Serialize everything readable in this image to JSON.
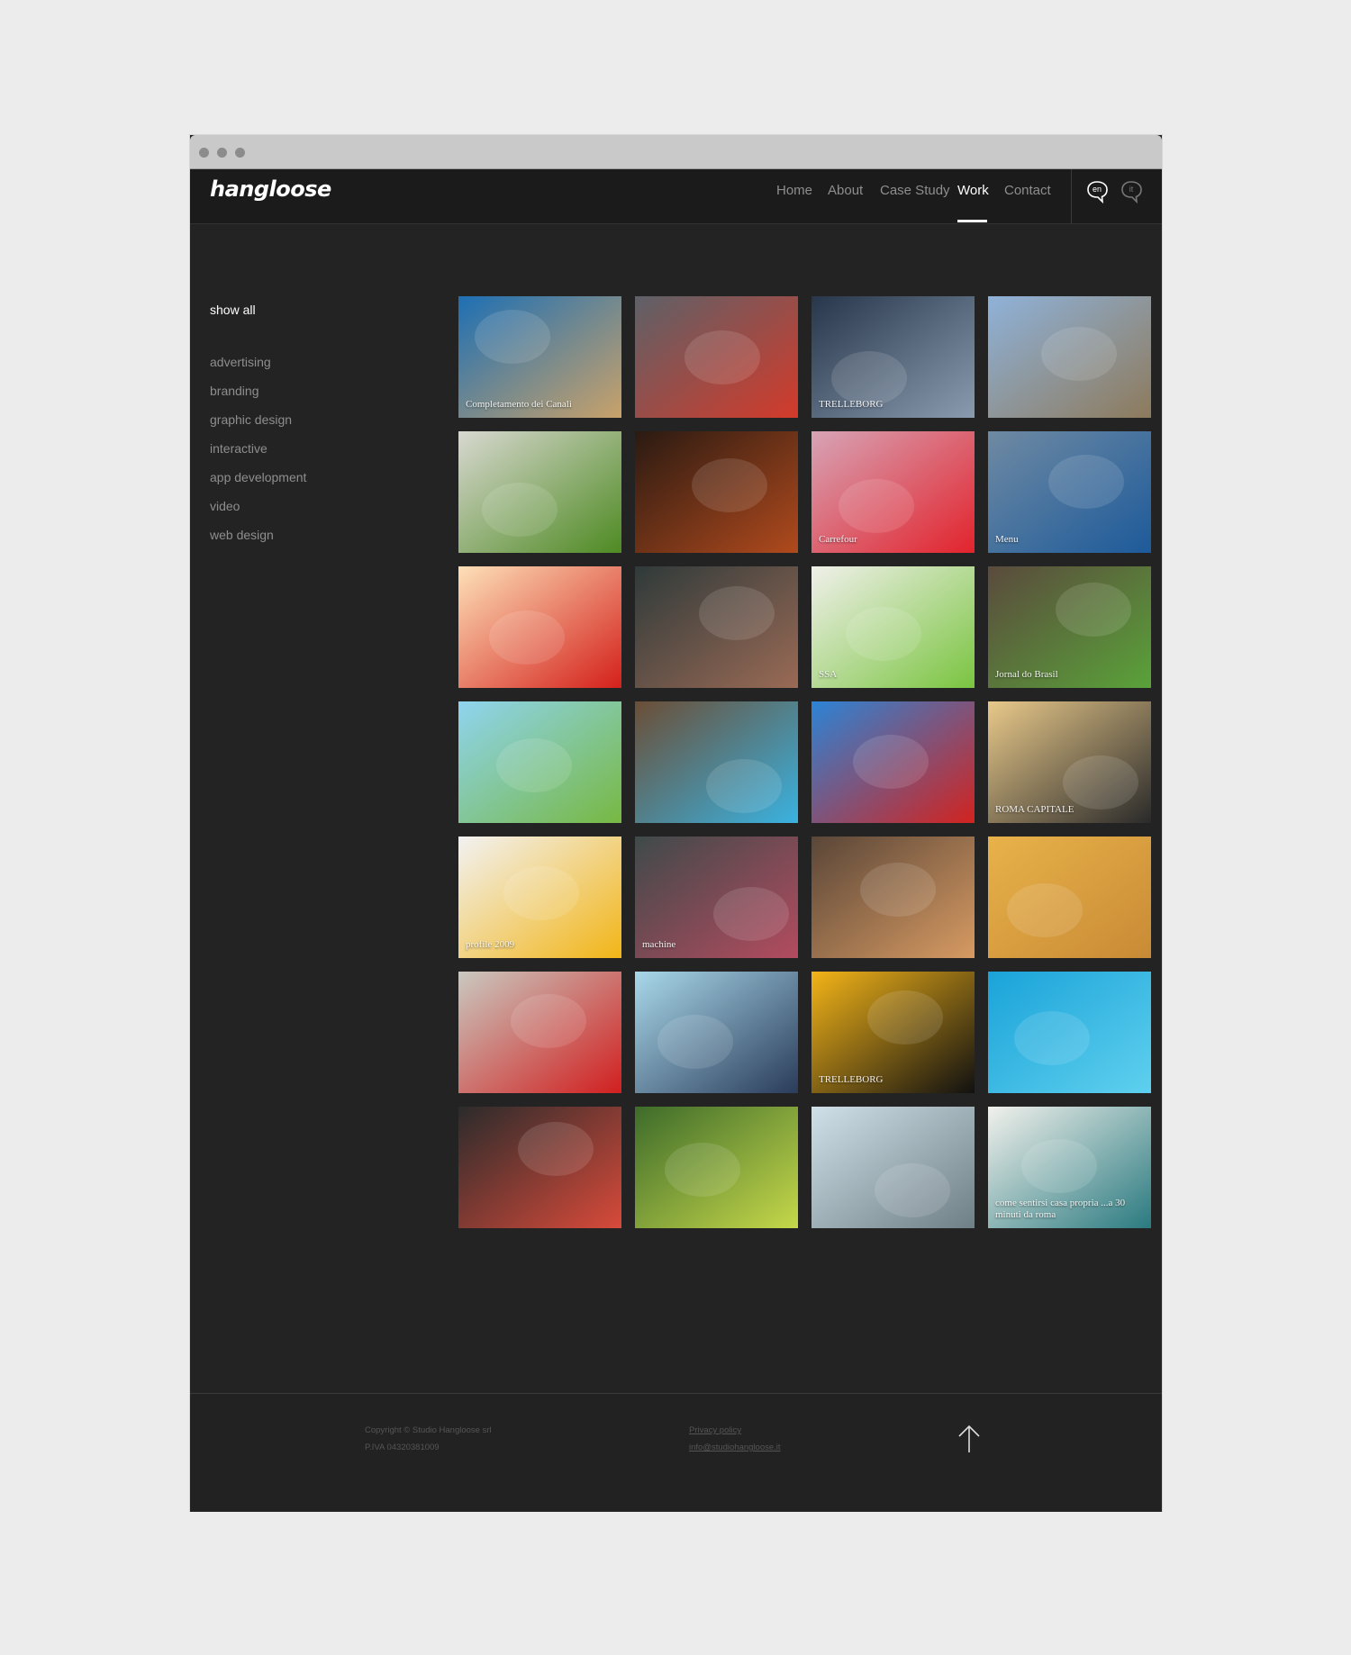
{
  "brand": {
    "logo": "hangloose"
  },
  "nav": {
    "items": [
      {
        "label": "Home",
        "active": false
      },
      {
        "label": "About",
        "active": false
      },
      {
        "label": "Case Study",
        "active": false
      },
      {
        "label": "Work",
        "active": true
      },
      {
        "label": "Contact",
        "active": false
      }
    ]
  },
  "languages": [
    {
      "code": "en",
      "selected": true,
      "icon": "speech-bubble-icon"
    },
    {
      "code": "it",
      "selected": false,
      "icon": "speech-bubble-icon"
    }
  ],
  "filters": {
    "show_all": "show all",
    "items": [
      "advertising",
      "branding",
      "graphic design",
      "interactive",
      "app development",
      "video",
      "web design"
    ]
  },
  "footer": {
    "copyright": "Copyright © Studio Hangloose srl",
    "vat": "P.IVA 04320381009",
    "privacy": "Privacy policy",
    "email": "info@studiohangloose.it",
    "top_icon": "arrow-up-icon"
  },
  "colors": {
    "page_bg": "#ececec",
    "site_bg": "#232323",
    "header_bg": "#1b1b1b",
    "active": "#ffffff",
    "muted": "#8e8e8e"
  },
  "portfolio": {
    "tiles": [
      {
        "caption": "Completamento dei Canali",
        "c1": "#1d6fb4",
        "c2": "#c9a26a"
      },
      {
        "caption": "",
        "c1": "#5d6168",
        "c2": "#d33a2a"
      },
      {
        "caption": "TRELLEBORG",
        "c1": "#27364a",
        "c2": "#8a9bb0"
      },
      {
        "caption": "",
        "c1": "#8fb2d9",
        "c2": "#8d7a5c"
      },
      {
        "caption": "",
        "c1": "#d8d8d0",
        "c2": "#4e8a22"
      },
      {
        "caption": "",
        "c1": "#2a1a12",
        "c2": "#b04a1d"
      },
      {
        "caption": "Carrefour",
        "c1": "#d7a4b6",
        "c2": "#e2232c"
      },
      {
        "caption": "Menu",
        "c1": "#6f8aa3",
        "c2": "#1d5a9a"
      },
      {
        "caption": "",
        "c1": "#fde0b8",
        "c2": "#d4201a"
      },
      {
        "caption": "",
        "c1": "#2f3a3a",
        "c2": "#9a6a55"
      },
      {
        "caption": "SSA",
        "c1": "#f0f0ea",
        "c2": "#7ac440"
      },
      {
        "caption": "Jornal do Brasil",
        "c1": "#5a4a3c",
        "c2": "#5aa23a"
      },
      {
        "caption": "",
        "c1": "#8fd4ef",
        "c2": "#77b842"
      },
      {
        "caption": "",
        "c1": "#6b4e36",
        "c2": "#3ab2e0"
      },
      {
        "caption": "",
        "c1": "#2c84d6",
        "c2": "#d2231f"
      },
      {
        "caption": "ROMA CAPITALE",
        "c1": "#e9c98a",
        "c2": "#2a2a2a"
      },
      {
        "caption": "profile 2009",
        "c1": "#f2f2f2",
        "c2": "#f2b517"
      },
      {
        "caption": "machine",
        "c1": "#3f4a4a",
        "c2": "#b34b5f"
      },
      {
        "caption": "",
        "c1": "#5a4638",
        "c2": "#d79a62"
      },
      {
        "caption": "",
        "c1": "#e8b24a",
        "c2": "#c98a35"
      },
      {
        "caption": "",
        "c1": "#c9c9c0",
        "c2": "#d11f1f"
      },
      {
        "caption": "",
        "c1": "#a9d8ea",
        "c2": "#2a3c5a"
      },
      {
        "caption": "TRELLEBORG",
        "c1": "#f3b418",
        "c2": "#111111"
      },
      {
        "caption": "",
        "c1": "#1aa3d9",
        "c2": "#5fd0ee"
      },
      {
        "caption": "",
        "c1": "#2b2b2b",
        "c2": "#d84a3a"
      },
      {
        "caption": "",
        "c1": "#3d6b2a",
        "c2": "#c6d84a"
      },
      {
        "caption": "",
        "c1": "#cfe0e8",
        "c2": "#6f7f86"
      },
      {
        "caption": "come sentirsi casa propria ...a 30 minuti da roma",
        "c1": "#f1f1ec",
        "c2": "#2a7a80"
      }
    ]
  }
}
